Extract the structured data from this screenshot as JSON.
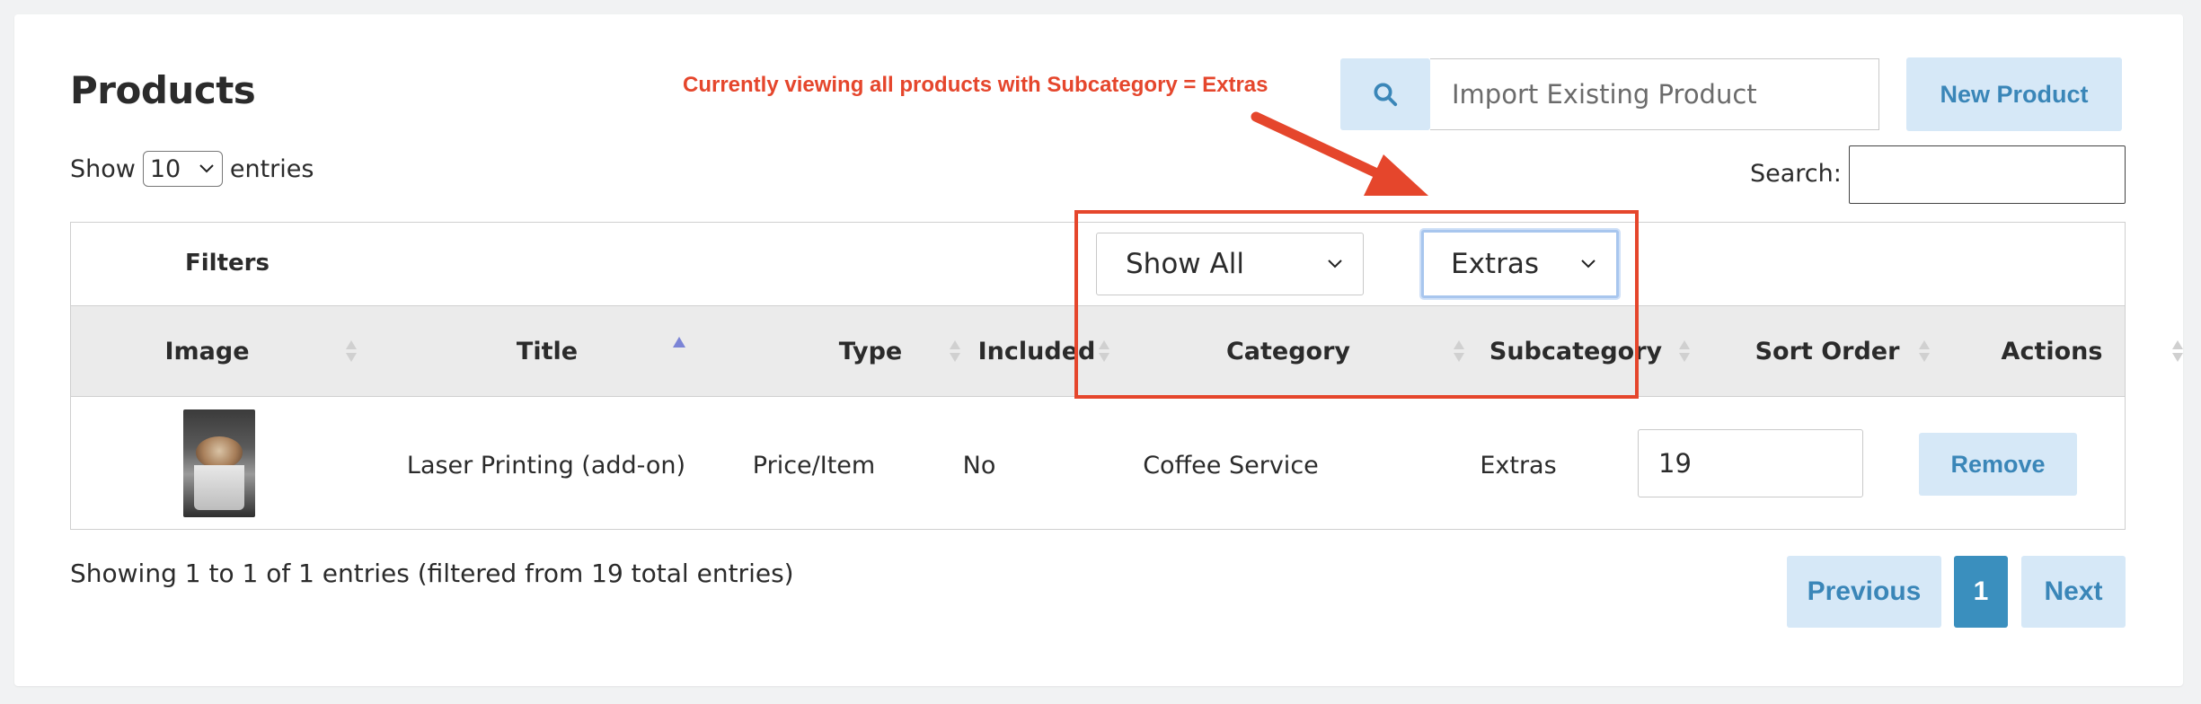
{
  "page_title": "Products",
  "annotation": "Currently viewing all products with Subcategory = Extras",
  "colors": {
    "accent": "#3a86b8",
    "button_bg": "#d6e8f7",
    "annotation": "#e5462c",
    "current_page": "#3a8fbe",
    "header_bg": "#ebebeb"
  },
  "toolbar": {
    "search_icon": "search-icon",
    "import_placeholder": "Import Existing Product",
    "new_product_label": "New Product"
  },
  "length_menu": {
    "prefix": "Show",
    "value": "10",
    "suffix": "entries"
  },
  "search": {
    "label": "Search:",
    "value": ""
  },
  "filters": {
    "label": "Filters",
    "category_value": "Show All",
    "subcategory_value": "Extras"
  },
  "table": {
    "columns": [
      "Image",
      "Title",
      "Type",
      "Included",
      "Category",
      "Subcategory",
      "Sort Order",
      "Actions"
    ],
    "rows": [
      {
        "image": "coffee-cup-thumbnail",
        "title": "Laser Printing (add-on)",
        "type": "Price/Item",
        "included": "No",
        "category": "Coffee Service",
        "subcategory": "Extras",
        "sort_order": "19",
        "action_label": "Remove"
      }
    ]
  },
  "info_text": "Showing 1 to 1 of 1 entries (filtered from 19 total entries)",
  "pagination": {
    "previous": "Previous",
    "current": "1",
    "next": "Next"
  }
}
